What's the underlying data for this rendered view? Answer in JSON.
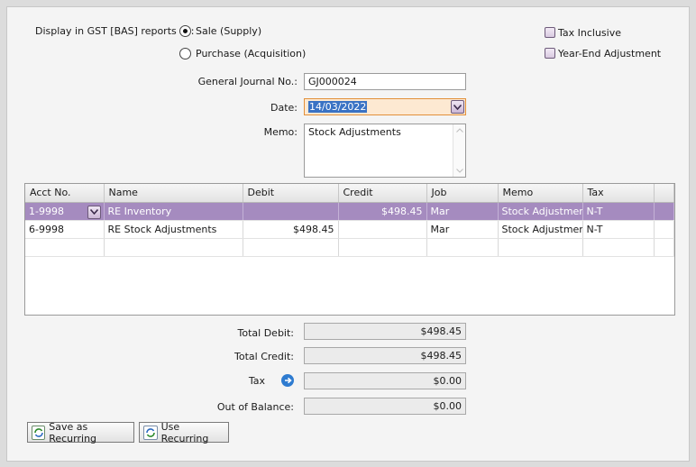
{
  "display_gst_label": "Display in GST [BAS] reports as:",
  "radio_sale": "Sale (Supply)",
  "radio_purchase": "Purchase (Acquisition)",
  "tax_inclusive_label": "Tax Inclusive",
  "year_end_label": "Year-End Adjustment",
  "journal_no_label": "General Journal No.:",
  "journal_no_value": "GJ000024",
  "date_label": "Date:",
  "date_value": "14/03/2022",
  "memo_label": "Memo:",
  "memo_value": "Stock Adjustments",
  "grid": {
    "headers": [
      "Acct No.",
      "Name",
      "Debit",
      "Credit",
      "Job",
      "Memo",
      "Tax",
      ""
    ],
    "rows": [
      [
        "1-9998",
        "RE Inventory",
        "",
        "$498.45",
        "Mar",
        "Stock Adjustment",
        "N-T",
        ""
      ],
      [
        "6-9998",
        "RE Stock Adjustments",
        "$498.45",
        "",
        "Mar",
        "Stock Adjustment",
        "N-T",
        ""
      ]
    ]
  },
  "totals": {
    "debit_label": "Total Debit:",
    "debit_value": "$498.45",
    "credit_label": "Total Credit:",
    "credit_value": "$498.45",
    "tax_label": "Tax",
    "tax_value": "$0.00",
    "out_of_balance_label": "Out of Balance:",
    "out_of_balance_value": "$0.00"
  },
  "buttons": {
    "save_recurring": "Save as Recurring",
    "use_recurring": "Use Recurring"
  },
  "colors": {
    "selected_row": "#a58bbf",
    "date_field_bg": "#fde9d2"
  }
}
